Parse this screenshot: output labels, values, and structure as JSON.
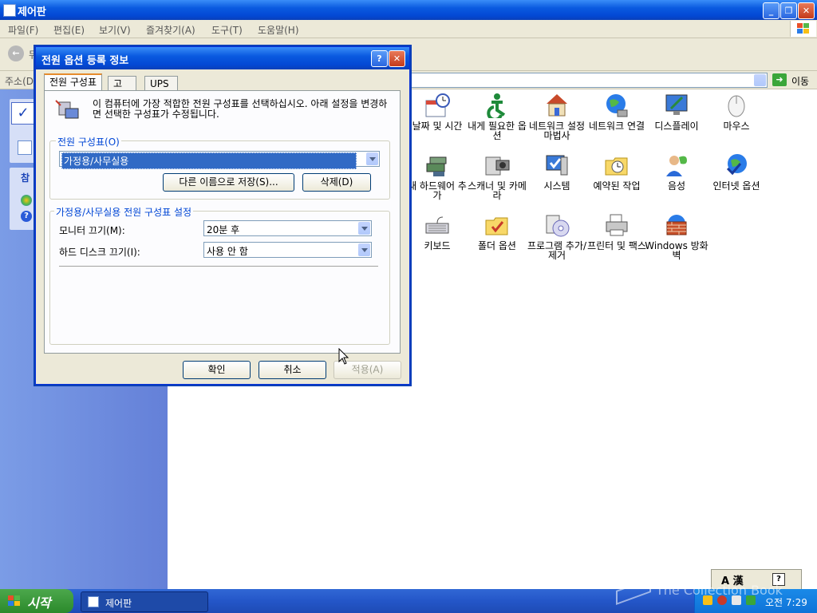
{
  "window": {
    "title": "제어판"
  },
  "menu": [
    "파일(F)",
    "편집(E)",
    "보기(V)",
    "즐겨찾기(A)",
    "도구(T)",
    "도움말(H)"
  ],
  "toolbar": {
    "back_label": "뒤"
  },
  "address": {
    "label": "주소(D)",
    "go_label": "이동"
  },
  "sidebar": {
    "section_label": "참"
  },
  "control_panel_items": [
    {
      "label": "날짜 및 시간",
      "icon": "calendar-clock-icon"
    },
    {
      "label": "내게 필요한 옵션",
      "icon": "accessibility-icon"
    },
    {
      "label": "네트워크 설정 마법사",
      "icon": "network-wizard-icon"
    },
    {
      "label": "네트워크 연결",
      "icon": "network-connections-icon"
    },
    {
      "label": "디스플레이",
      "icon": "display-icon"
    },
    {
      "label": "마우스",
      "icon": "mouse-icon"
    },
    {
      "label": "새 하드웨어 추가",
      "icon": "add-hardware-icon"
    },
    {
      "label": "스캐너 및 카메라",
      "icon": "scanner-camera-icon"
    },
    {
      "label": "시스템",
      "icon": "system-icon"
    },
    {
      "label": "예약된 작업",
      "icon": "scheduled-tasks-icon"
    },
    {
      "label": "음성",
      "icon": "speech-icon"
    },
    {
      "label": "인터넷 옵션",
      "icon": "internet-options-icon"
    },
    {
      "label": "키보드",
      "icon": "keyboard-icon"
    },
    {
      "label": "폴더 옵션",
      "icon": "folder-options-icon"
    },
    {
      "label": "프로그램 추가/제거",
      "icon": "add-remove-programs-icon"
    },
    {
      "label": "프린터 및 팩스",
      "icon": "printers-faxes-icon"
    },
    {
      "label": "Windows 방화벽",
      "icon": "firewall-icon"
    }
  ],
  "dialog": {
    "title": "전원 옵션 등록 정보",
    "tabs": [
      "전원 구성표",
      "고급",
      "UPS"
    ],
    "description": "이 컴퓨터에 가장 적합한 전원 구성표를 선택하십시오. 아래 설정을 변경하면 선택한 구성표가 수정됩니다.",
    "scheme_group_label": "전원 구성표(O)",
    "scheme_value": "가정용/사무실용",
    "save_as_label": "다른 이름으로 저장(S)...",
    "delete_label": "삭제(D)",
    "settings_group_label": "가정용/사무실용 전원 구성표 설정",
    "monitor_label": "모니터 끄기(M):",
    "monitor_value": "20분 후",
    "disk_label": "하드 디스크 끄기(I):",
    "disk_value": "사용 안 함",
    "ok_label": "확인",
    "cancel_label": "취소",
    "apply_label": "적용(A)"
  },
  "taskbar": {
    "start_label": "시작",
    "task_label": "제어판",
    "clock": "오전 7:29"
  },
  "langbar": {
    "text": "A 漢"
  },
  "watermark": "The Collection Book"
}
